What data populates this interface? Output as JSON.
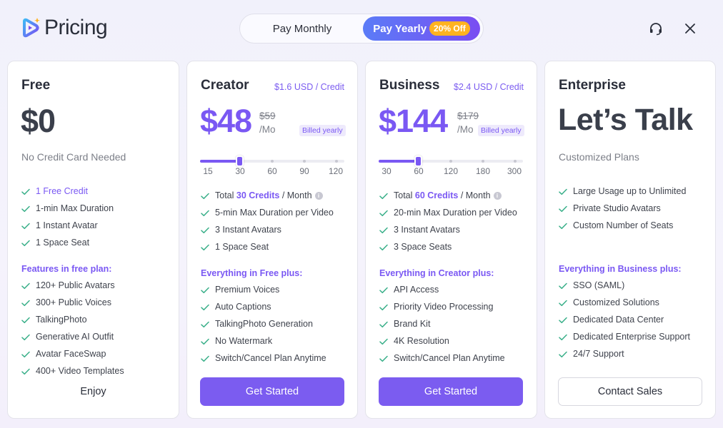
{
  "header": {
    "title": "Pricing",
    "toggle": {
      "monthly": "Pay Monthly",
      "yearly": "Pay Yearly",
      "discount": "20% Off"
    },
    "icons": [
      "headset-icon",
      "close-icon"
    ],
    "accent": "#7a58f3"
  },
  "plans": [
    {
      "name": "Free",
      "price": "$0",
      "subtitle": "No Credit Card Needed",
      "features": [
        "1 Free Credit",
        "1-min Max Duration",
        "1 Instant Avatar",
        "1 Space Seat"
      ],
      "section_label": "Features in free plan:",
      "extras": [
        "120+ Public Avatars",
        "300+ Public Voices",
        "TalkingPhoto",
        "Generative AI Outfit",
        "Avatar FaceSwap",
        "400+ Video Templates"
      ],
      "cta": "Enjoy"
    },
    {
      "name": "Creator",
      "per_credit": "$1.6 USD / Credit",
      "price": "$48",
      "old_price": "$59",
      "per_mo": "/Mo",
      "billed": "Billed yearly",
      "slider": {
        "ticks": [
          "15",
          "30",
          "60",
          "90",
          "120"
        ],
        "selected": "30"
      },
      "credits_prefix": "Total",
      "credits": "30 Credits",
      "credits_suffix": "/ Month",
      "features": [
        "5-min Max Duration per Video",
        "3 Instant Avatars",
        "1 Space Seat"
      ],
      "section_label": "Everything in Free plus:",
      "extras": [
        "Premium Voices",
        "Auto Captions",
        "TalkingPhoto Generation",
        "No Watermark",
        "Switch/Cancel Plan Anytime"
      ],
      "cta": "Get Started"
    },
    {
      "name": "Business",
      "per_credit": "$2.4 USD / Credit",
      "price": "$144",
      "old_price": "$179",
      "per_mo": "/Mo",
      "billed": "Billed yearly",
      "slider": {
        "ticks": [
          "30",
          "60",
          "120",
          "180",
          "300"
        ],
        "selected": "60"
      },
      "credits_prefix": "Total",
      "credits": "60 Credits",
      "credits_suffix": "/ Month",
      "features": [
        "20-min Max Duration per Video",
        "3 Instant Avatars",
        "3 Space Seats"
      ],
      "section_label": "Everything in Creator plus:",
      "extras": [
        "API Access",
        "Priority Video Processing",
        "Brand Kit",
        "4K Resolution",
        "Switch/Cancel Plan Anytime"
      ],
      "cta": "Get Started"
    },
    {
      "name": "Enterprise",
      "price": "Let’s Talk",
      "subtitle": "Customized Plans",
      "features": [
        "Large Usage up to Unlimited",
        "Private Studio Avatars",
        "Custom Number of Seats"
      ],
      "section_label": "Everything in Business plus:",
      "extras": [
        "SSO (SAML)",
        "Customized Solutions",
        "Dedicated Data Center",
        "Dedicated Enterprise Support",
        "24/7 Support"
      ],
      "cta": "Contact Sales"
    }
  ]
}
